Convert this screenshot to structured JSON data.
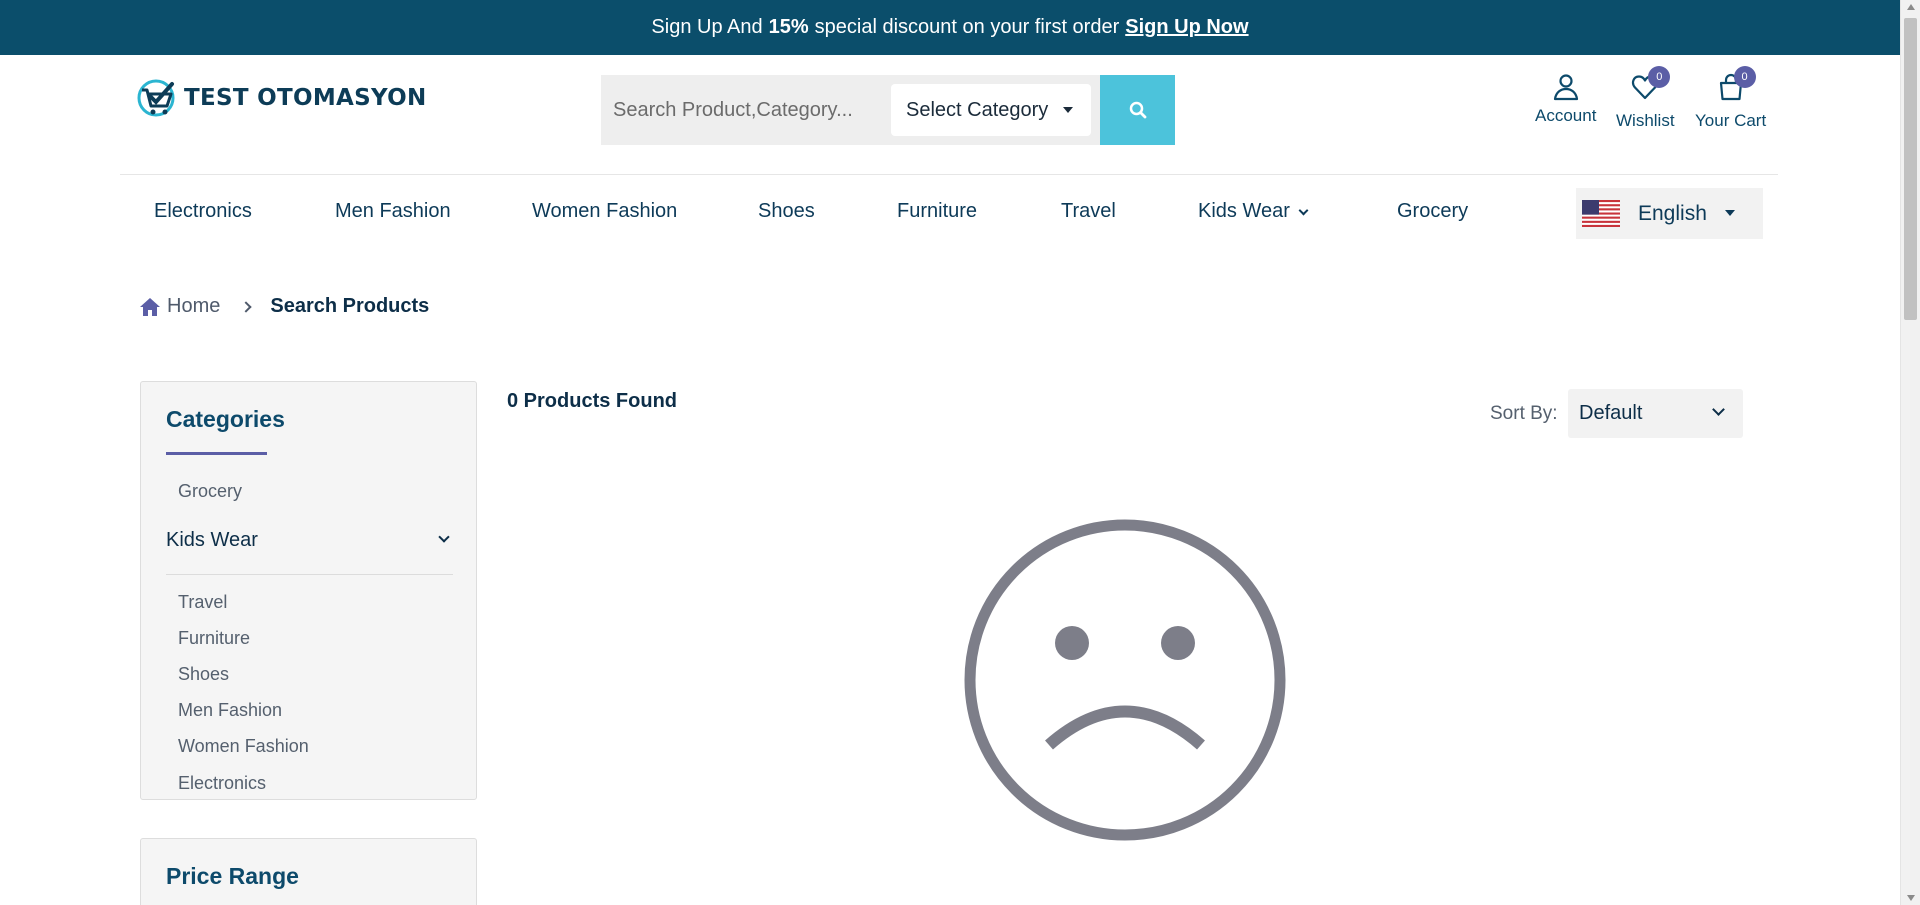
{
  "announcement": {
    "prefix": "Sign Up And",
    "discount": "15%",
    "suffix": "special discount on your first order",
    "link": "Sign Up Now"
  },
  "header": {
    "logo_text": "TEST OTOMASYON",
    "search_placeholder": "Search Product,Category...",
    "category_select": "Select Category",
    "account_label": "Account",
    "wishlist_label": "Wishlist",
    "wishlist_count": "0",
    "cart_label": "Your Cart",
    "cart_count": "0"
  },
  "nav": {
    "items": [
      "Electronics",
      "Men Fashion",
      "Women Fashion",
      "Shoes",
      "Furniture",
      "Travel",
      "Kids Wear",
      "Grocery"
    ],
    "language": "English"
  },
  "breadcrumb": {
    "home": "Home",
    "current": "Search Products"
  },
  "sidebar": {
    "categories_title": "Categories",
    "top_item": "Grocery",
    "parent": "Kids Wear",
    "children": [
      "Travel",
      "Furniture",
      "Shoes",
      "Men Fashion",
      "Women Fashion",
      "Electronics"
    ],
    "price_title": "Price Range"
  },
  "main": {
    "found_text": "0 Products Found",
    "sort_label": "Sort By:",
    "sort_value": "Default"
  },
  "colors": {
    "topbar": "#0b4e6b",
    "search_button": "#4cc3db",
    "badge": "#5b5ea6",
    "sad_face": "#7d7e89"
  },
  "icons": [
    "search-icon",
    "user-icon",
    "heart-icon",
    "bag-icon",
    "home-icon",
    "us-flag-icon",
    "sad-face-icon"
  ]
}
